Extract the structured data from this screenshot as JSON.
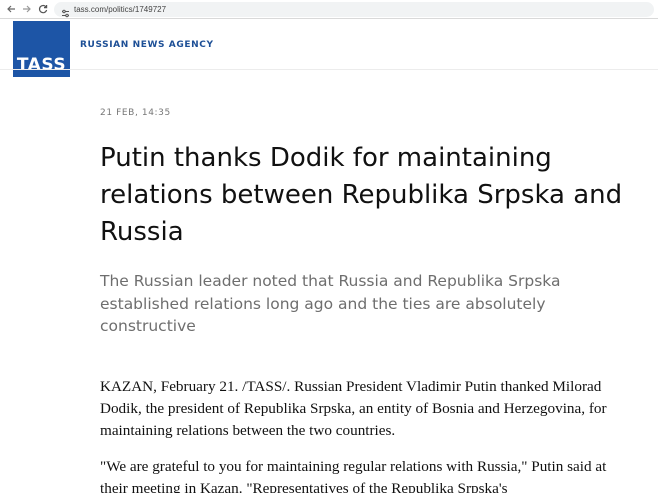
{
  "browser": {
    "url": "tass.com/politics/1749727"
  },
  "header": {
    "logo_text": "TASS",
    "agency_label": "RUSSIAN NEWS AGENCY",
    "logo_color": "#1d55a6"
  },
  "article": {
    "date": "21 FEB, 14:35",
    "title": "Putin thanks Dodik for maintaining relations between Republika Srpska and Russia",
    "lead": "The Russian leader noted that Russia and Republika Srpska established relations long ago and the ties are absolutely constructive",
    "paragraphs": [
      "KAZAN, February 21. /TASS/. Russian President Vladimir Putin thanked Milorad Dodik, the president of Republika Srpska, an entity of Bosnia and Herzegovina, for maintaining relations between the two countries.",
      "\"We are grateful to you for maintaining regular relations with Russia,\" Putin said at their meeting in Kazan. \"Representatives of the Republika Srpska's"
    ]
  },
  "icons": {
    "back": "back-arrow-icon",
    "forward": "forward-arrow-icon",
    "reload": "reload-icon",
    "site_info": "site-info-icon"
  }
}
